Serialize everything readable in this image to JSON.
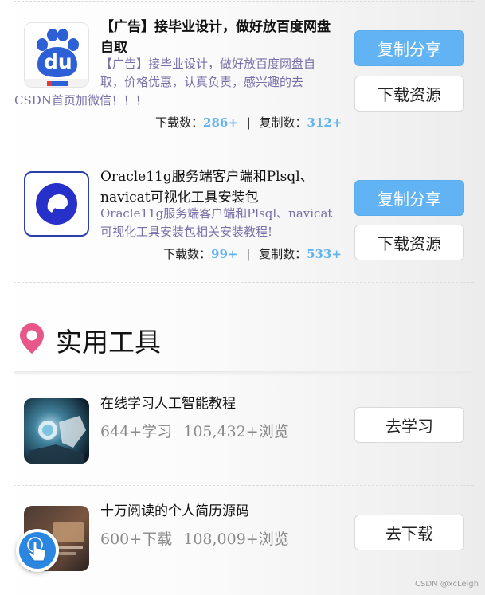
{
  "ads": [
    {
      "title": "【广告】接毕业设计，做好放百度网盘自取",
      "title_line1": "【广告】接毕业设计，做好放百度网盘",
      "title_line2": "自取",
      "desc_line1": "【广告】接毕业设计，做好放百度网盘自",
      "desc_line2": "取，价格优惠，认真负责，感兴趣的去",
      "desc_line3": "CSDN首页加微信！！！",
      "downloads_label": "下载数：",
      "downloads": "286+",
      "divider": "|",
      "copies_label": "复制数：",
      "copies": "312+",
      "share_button": "复制分享",
      "download_button": "下载资源",
      "icon": "baidu-netdisk-icon",
      "icon_text": "du"
    },
    {
      "title_line1": "Oracle11g服务端客户端和Plsql、",
      "title_line2": "navicat可视化工具安装包",
      "desc_line1": "Oracle11g服务端客户端和Plsql、navicat",
      "desc_line2": "可视化工具安装包相关安装教程!",
      "downloads_label": "下载数：",
      "downloads": "99+",
      "divider": "|",
      "copies_label": "复制数：",
      "copies": "533+",
      "share_button": "复制分享",
      "download_button": "下载资源",
      "icon": "blue-circle-app-icon"
    }
  ],
  "section": {
    "icon": "location-pin-icon",
    "title": "实用工具"
  },
  "tools": [
    {
      "title": "在线学习人工智能教程",
      "stats_count": "644+学习",
      "stats_views": "105,432+浏览",
      "button": "去学习",
      "icon": "ai-robot-thumbnail"
    },
    {
      "title": "十万阅读的个人简历源码",
      "stats_count": "600+下载",
      "stats_views": "108,009+浏览",
      "button": "去下载",
      "icon": "resume-thumbnail"
    }
  ],
  "floating": {
    "icon": "hand-pointer-icon"
  },
  "watermark": "CSDN @xcLeigh",
  "colors": {
    "accent": "#61b3f3",
    "desc": "#7a6fa8",
    "pin": "#e8578a"
  }
}
